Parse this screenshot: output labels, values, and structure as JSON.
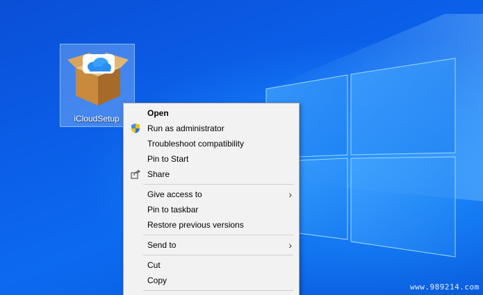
{
  "desktop": {
    "icon": {
      "label": "iCloudSetup",
      "icon_name": "icloud-setup-box-icon"
    }
  },
  "context_menu": {
    "items": [
      {
        "label": "Open",
        "bold": true
      },
      {
        "label": "Run as administrator",
        "icon": "uac-shield-icon"
      },
      {
        "label": "Troubleshoot compatibility"
      },
      {
        "label": "Pin to Start"
      },
      {
        "label": "Share",
        "icon": "share-icon"
      },
      {
        "label": "Give access to",
        "submenu": true
      },
      {
        "label": "Pin to taskbar"
      },
      {
        "label": "Restore previous versions"
      },
      {
        "label": "Send to",
        "submenu": true
      },
      {
        "label": "Cut"
      },
      {
        "label": "Copy"
      }
    ]
  },
  "watermark": "www.989214.com",
  "colors": {
    "desktop_blue": "#0b5ce6",
    "menu_background": "#f2f2f2",
    "selection_highlight": "#add8ff"
  }
}
